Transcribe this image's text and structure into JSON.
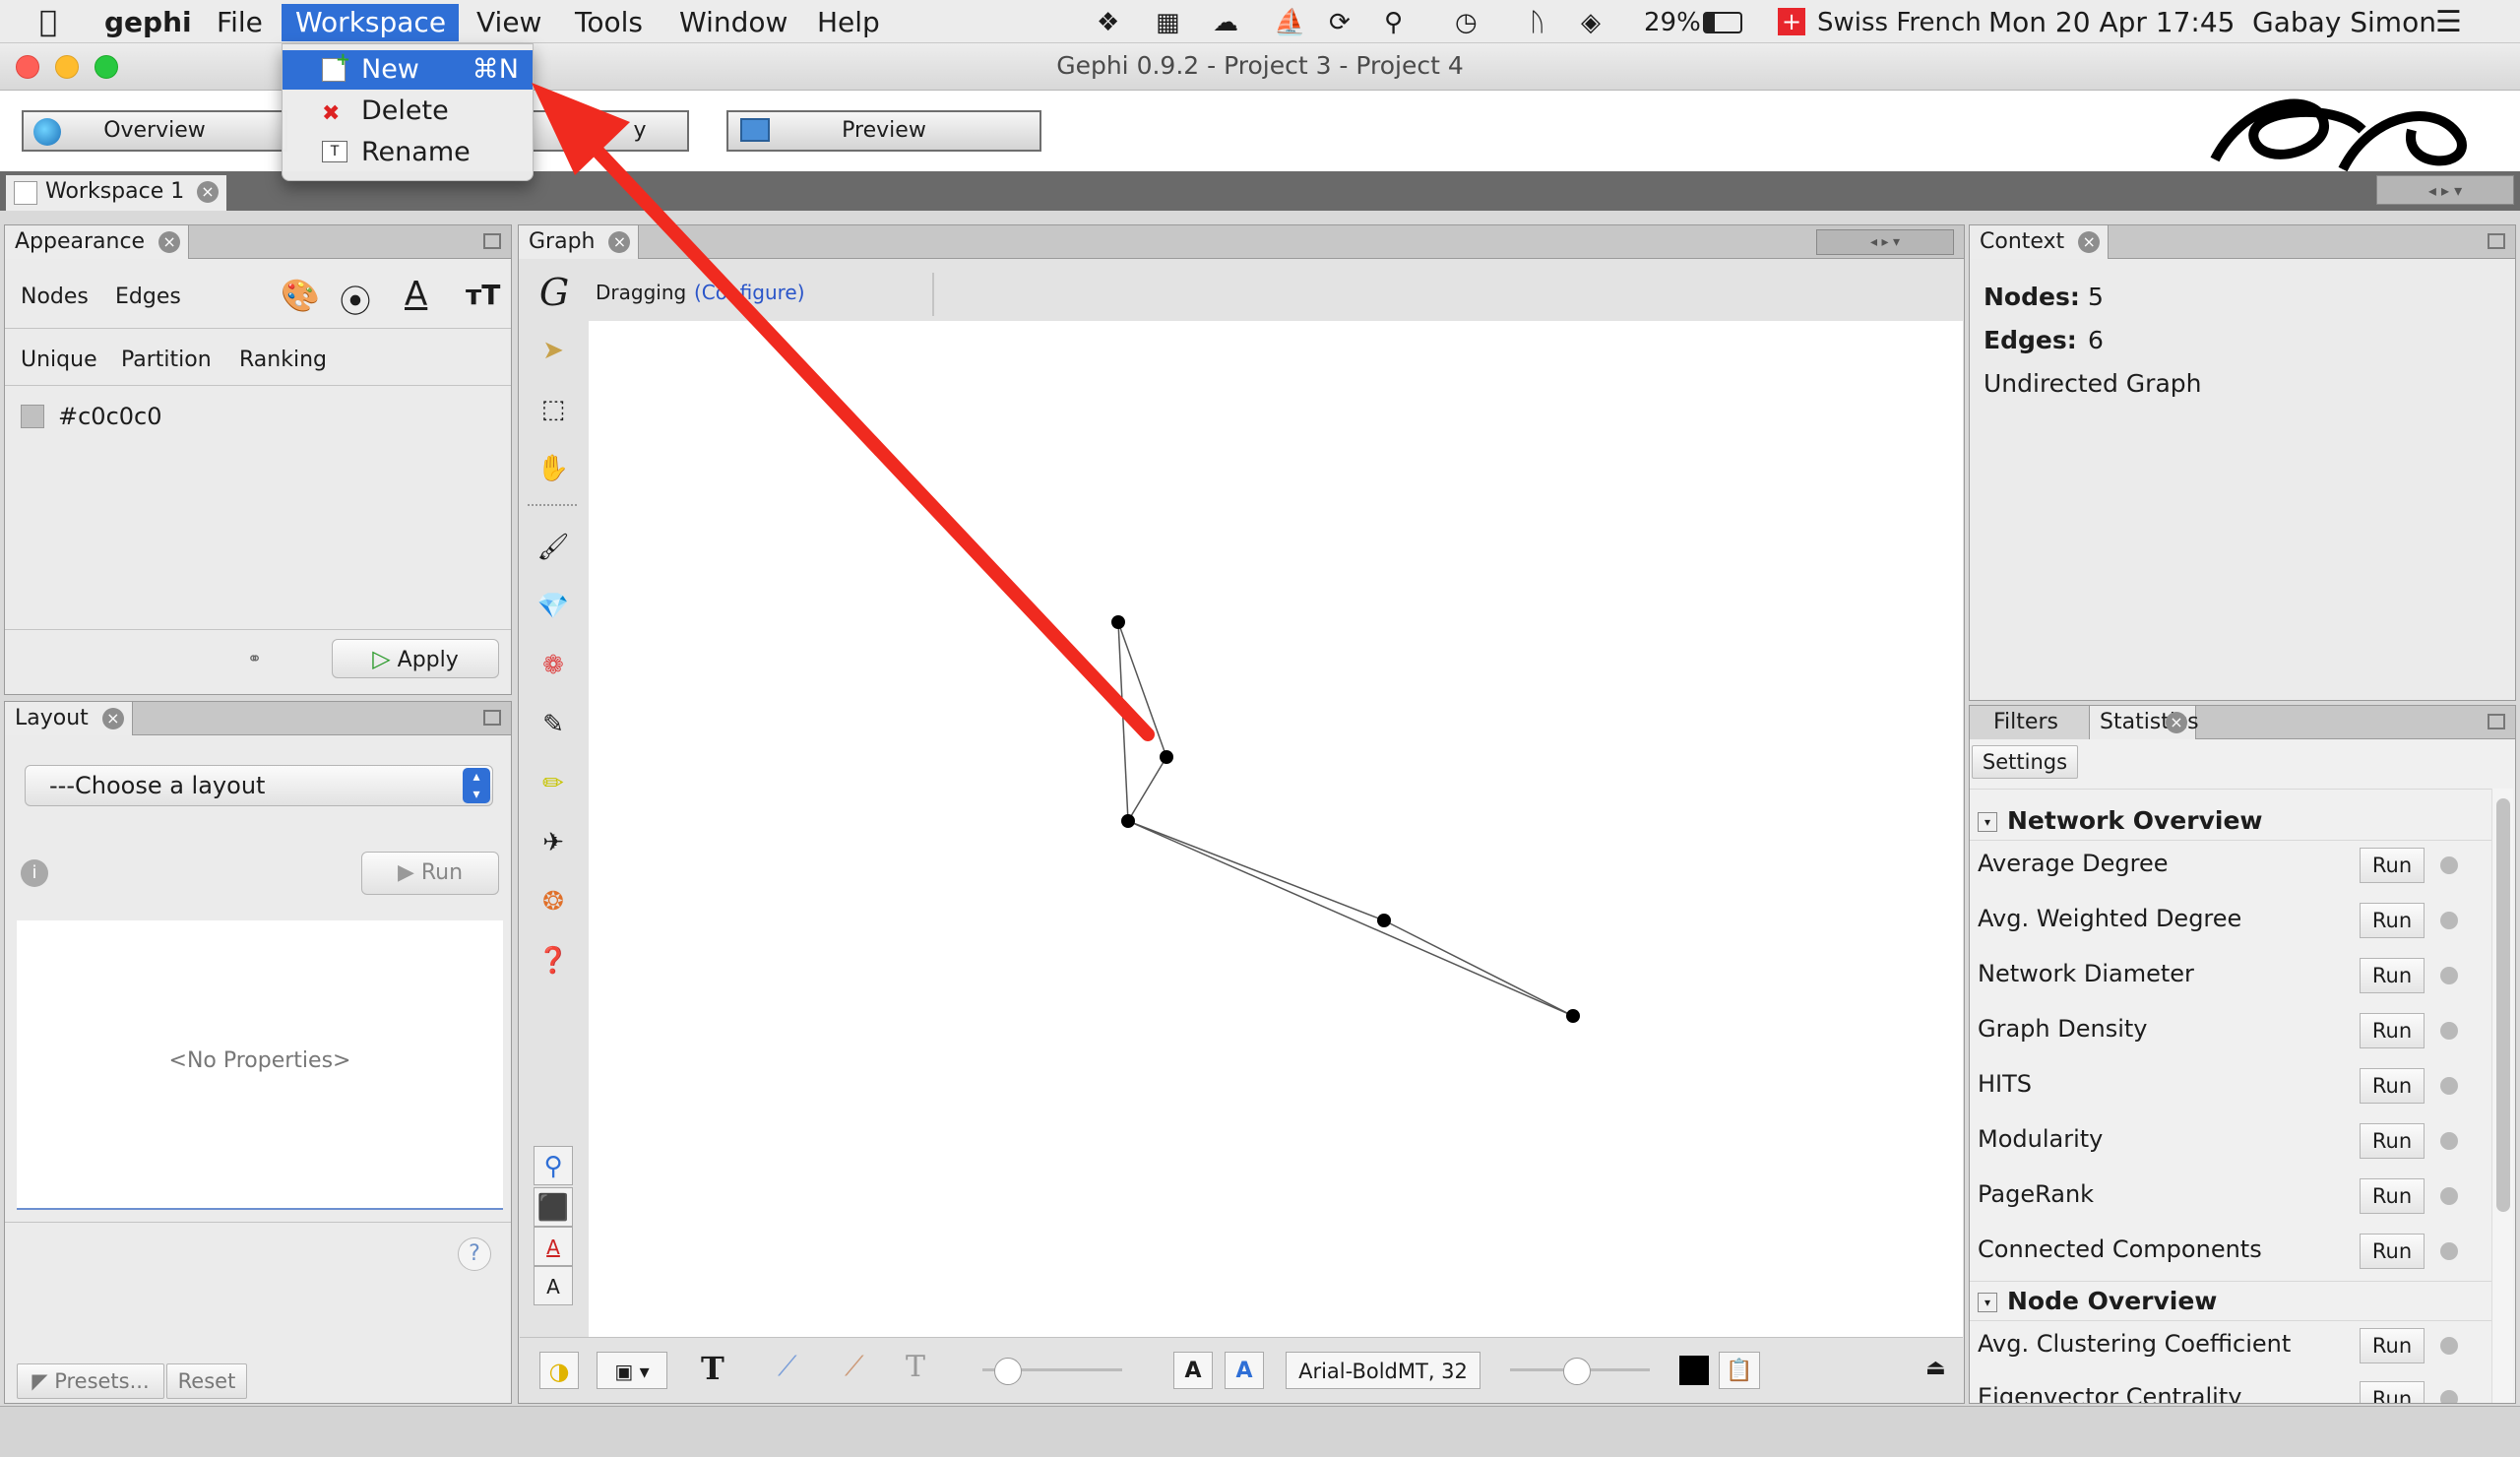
{
  "menubar": {
    "app": "gephi",
    "items": [
      "File",
      "Workspace",
      "View",
      "Tools",
      "Window",
      "Help"
    ],
    "battery": "29%",
    "keyboard": "Swiss French",
    "datetime": "Mon 20 Apr  17:45",
    "user": "Gabay Simon"
  },
  "window": {
    "title": "Gephi 0.9.2 - Project 3 - Project 4"
  },
  "workspace_menu": {
    "items": [
      {
        "label": "New",
        "shortcut": "⌘N"
      },
      {
        "label": "Delete"
      },
      {
        "label": "Rename"
      }
    ]
  },
  "toolbar": {
    "overview": "Overview",
    "data_lab": "y",
    "preview": "Preview"
  },
  "workspace_tab": "Workspace 1",
  "appearance": {
    "tab": "Appearance",
    "subtabs": [
      "Nodes",
      "Edges"
    ],
    "modes": [
      "Unique",
      "Partition",
      "Ranking"
    ],
    "color_value": "#c0c0c0",
    "apply": "Apply"
  },
  "layout": {
    "tab": "Layout",
    "choose": "---Choose a layout",
    "run": "Run",
    "no_properties": "<No Properties>",
    "presets": "Presets...",
    "reset": "Reset",
    "help": "?"
  },
  "graph": {
    "tab": "Graph",
    "tool_label": "Dragging",
    "configure": "(Configure)",
    "font": "Arial-BoldMT, 32"
  },
  "context": {
    "tab": "Context",
    "nodes_label": "Nodes:",
    "nodes": "5",
    "edges_label": "Edges:",
    "edges": "6",
    "type": "Undirected Graph"
  },
  "statistics": {
    "tabs": [
      "Filters",
      "Statistics"
    ],
    "settings": "Settings",
    "network_title": "Network Overview",
    "network": [
      "Average Degree",
      "Avg. Weighted Degree",
      "Network Diameter",
      "Graph Density",
      "HITS",
      "Modularity",
      "PageRank",
      "Connected Components"
    ],
    "node_title": "Node Overview",
    "node": [
      "Avg. Clustering Coefficient",
      "Eigenvector Centrality"
    ],
    "run": "Run"
  },
  "colors": {
    "accent": "#2f6fd6",
    "arrow": "#f02a1f"
  }
}
